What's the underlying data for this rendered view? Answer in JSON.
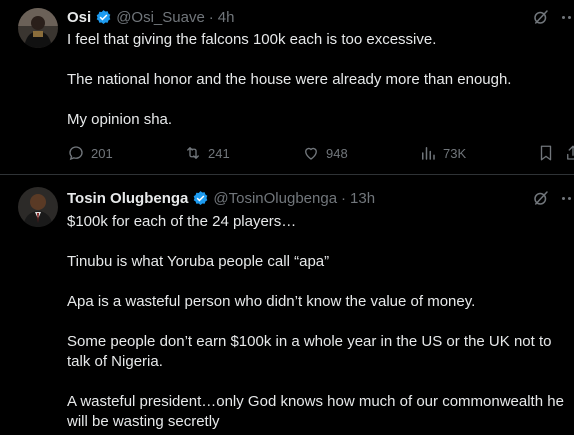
{
  "tweets": [
    {
      "author": {
        "name": "Osi",
        "handle": "@Osi_Suave",
        "time": "4h"
      },
      "paragraphs": [
        "I feel that giving the falcons 100k each is too excessive.",
        "The national honor and the house were already more than enough.",
        "My opinion sha."
      ],
      "stats": {
        "replies": "201",
        "reposts": "241",
        "likes": "948",
        "views": "73K"
      }
    },
    {
      "author": {
        "name": "Tosin Olugbenga",
        "handle": "@TosinOlugbenga",
        "time": "13h"
      },
      "paragraphs": [
        "$100k for each of the 24 players…",
        "Tinubu is what Yoruba people call “apa”",
        "Apa is a wasteful person who didn’t know the value of money.",
        "Some people don’t earn $100k in a whole year in the US or the UK not to talk of Nigeria.",
        "A wasteful president…only God knows how much of our commonwealth he will be wasting secretly"
      ]
    }
  ],
  "ui": {
    "separator": "·"
  },
  "colors": {
    "background": "#000000",
    "text": "#e7e9ea",
    "secondary": "#71767b",
    "verified": "#1d9bf0",
    "border": "#2f3336"
  }
}
